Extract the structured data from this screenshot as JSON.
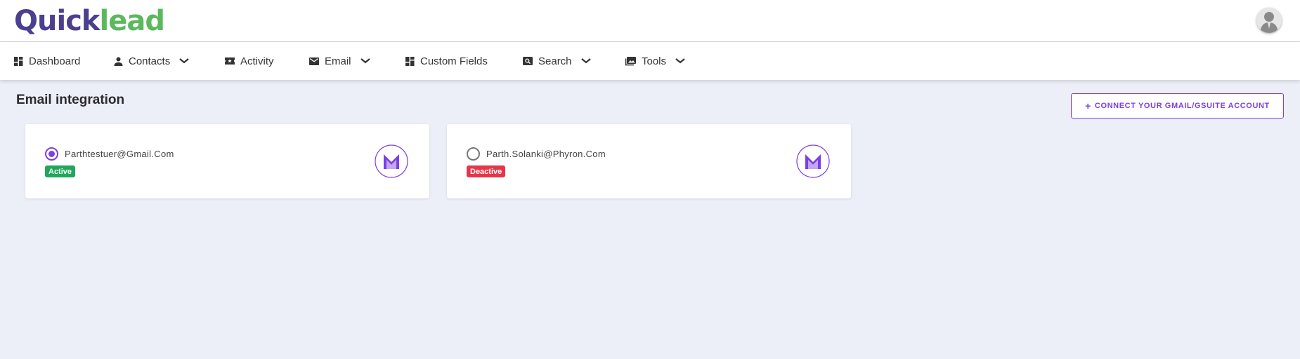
{
  "brand": {
    "part1": "Quick",
    "part2": "lead",
    "color1": "#4b3f8f",
    "color2": "#5cb85c"
  },
  "colors": {
    "accent": "#7b3fe4",
    "active": "#1fa85a",
    "deactive": "#e8354a",
    "background": "#eceef8"
  },
  "nav": {
    "items": [
      {
        "label": "Dashboard",
        "icon": "dashboard-icon",
        "dropdown": false
      },
      {
        "label": "Contacts",
        "icon": "person-icon",
        "dropdown": true
      },
      {
        "label": "Activity",
        "icon": "ticket-icon",
        "dropdown": false
      },
      {
        "label": "Email",
        "icon": "mail-icon",
        "dropdown": true
      },
      {
        "label": "Custom Fields",
        "icon": "dashboard-icon",
        "dropdown": false
      },
      {
        "label": "Search",
        "icon": "search-box-icon",
        "dropdown": true
      },
      {
        "label": "Tools",
        "icon": "photo-library-icon",
        "dropdown": true
      }
    ]
  },
  "page": {
    "title": "Email integration",
    "connect_button": {
      "plus": "+",
      "label": "CONNECT YOUR GMAIL/GSUITE ACCOUNT"
    }
  },
  "accounts": [
    {
      "email": "Parthtestuer@Gmail.Com",
      "status": "Active",
      "selected": true,
      "icon": "gmail-icon"
    },
    {
      "email": "Parth.Solanki@Phyron.Com",
      "status": "Deactive",
      "selected": false,
      "icon": "gmail-icon"
    }
  ]
}
